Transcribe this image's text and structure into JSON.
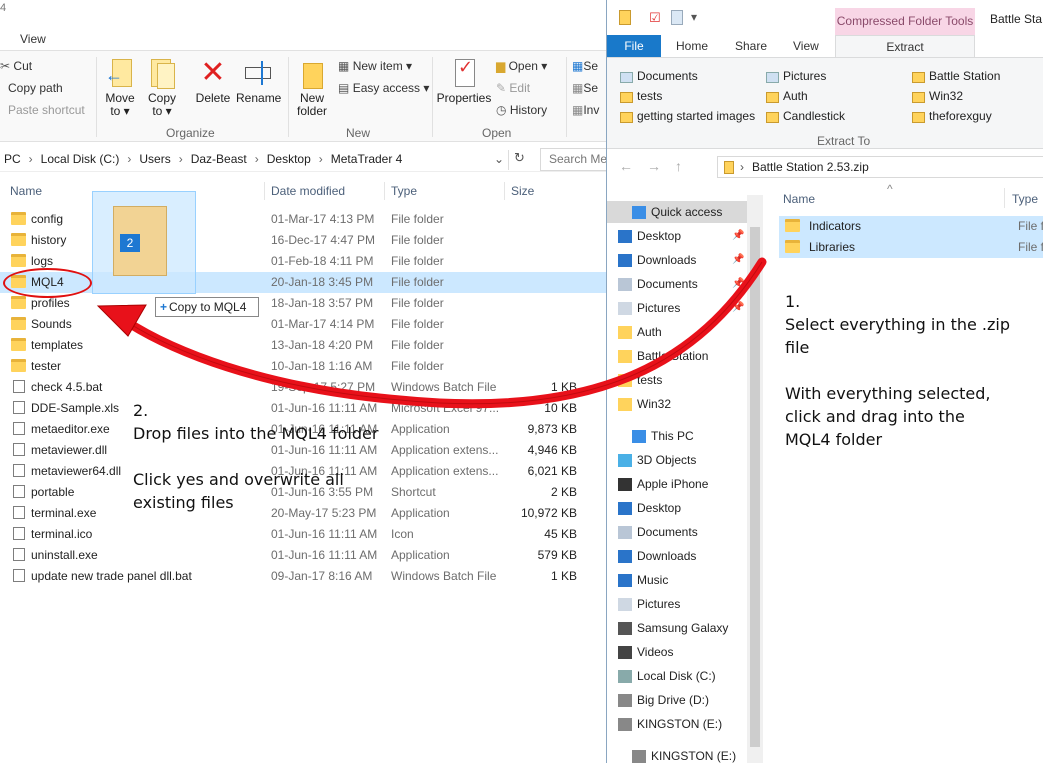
{
  "left_window": {
    "title_fragment": "4",
    "tab_view": "View",
    "ribbon": {
      "cut": "Cut",
      "copy_path": "Copy path",
      "paste_shortcut": "Paste shortcut",
      "move_to": "Move\nto ▾",
      "copy_to": "Copy\nto ▾",
      "delete": "Delete",
      "rename": "Rename",
      "new_folder": "New\nfolder",
      "new_item": "New item ▾",
      "easy_access": "Easy access ▾",
      "properties": "Properties",
      "open": "Open ▾",
      "edit": "Edit",
      "history": "History",
      "select_partial_1": "Se",
      "select_partial_2": "Se",
      "select_partial_3": "Inv",
      "group_organize": "Organize",
      "group_new": "New",
      "group_open": "Open"
    },
    "address": {
      "segments": [
        "PC",
        "Local Disk (C:)",
        "Users",
        "Daz-Beast",
        "Desktop",
        "MetaTrader 4"
      ],
      "search_placeholder": "Search Me"
    },
    "columns": {
      "name": "Name",
      "date": "Date modified",
      "type": "Type",
      "size": "Size"
    },
    "files": [
      {
        "name": "config",
        "date": "01-Mar-17 4:13 PM",
        "type": "File folder",
        "size": "",
        "kind": "folder"
      },
      {
        "name": "history",
        "date": "16-Dec-17 4:47 PM",
        "type": "File folder",
        "size": "",
        "kind": "folder"
      },
      {
        "name": "logs",
        "date": "01-Feb-18 4:11 PM",
        "type": "File folder",
        "size": "",
        "kind": "folder"
      },
      {
        "name": "MQL4",
        "date": "20-Jan-18 3:45 PM",
        "type": "File folder",
        "size": "",
        "kind": "folder"
      },
      {
        "name": "profiles",
        "date": "18-Jan-18 3:57 PM",
        "type": "File folder",
        "size": "",
        "kind": "folder"
      },
      {
        "name": "Sounds",
        "date": "01-Mar-17 4:14 PM",
        "type": "File folder",
        "size": "",
        "kind": "folder"
      },
      {
        "name": "templates",
        "date": "13-Jan-18 4:20 PM",
        "type": "File folder",
        "size": "",
        "kind": "folder"
      },
      {
        "name": "tester",
        "date": "10-Jan-18 1:16 AM",
        "type": "File folder",
        "size": "",
        "kind": "folder"
      },
      {
        "name": "check 4.5.bat",
        "date": "19-Sep-17 5:27 PM",
        "type": "Windows Batch File",
        "size": "1 KB",
        "kind": "file"
      },
      {
        "name": "DDE-Sample.xls",
        "date": "01-Jun-16 11:11 AM",
        "type": "Microsoft Excel 97...",
        "size": "10 KB",
        "kind": "file"
      },
      {
        "name": "metaeditor.exe",
        "date": "01-Jun-16 11:11 AM",
        "type": "Application",
        "size": "9,873 KB",
        "kind": "file"
      },
      {
        "name": "metaviewer.dll",
        "date": "01-Jun-16 11:11 AM",
        "type": "Application extens...",
        "size": "4,946 KB",
        "kind": "file"
      },
      {
        "name": "metaviewer64.dll",
        "date": "01-Jun-16 11:11 AM",
        "type": "Application extens...",
        "size": "6,021 KB",
        "kind": "file"
      },
      {
        "name": "portable",
        "date": "01-Jun-16 3:55 PM",
        "type": "Shortcut",
        "size": "2 KB",
        "kind": "file"
      },
      {
        "name": "terminal.exe",
        "date": "20-May-17 5:23 PM",
        "type": "Application",
        "size": "10,972 KB",
        "kind": "file"
      },
      {
        "name": "terminal.ico",
        "date": "01-Jun-16 11:11 AM",
        "type": "Icon",
        "size": "45 KB",
        "kind": "file"
      },
      {
        "name": "uninstall.exe",
        "date": "01-Jun-16 11:11 AM",
        "type": "Application",
        "size": "579 KB",
        "kind": "file"
      },
      {
        "name": "update new trade panel dll.bat",
        "date": "09-Jan-17 8:16 AM",
        "type": "Windows Batch File",
        "size": "1 KB",
        "kind": "file"
      }
    ],
    "drag_badge": "2",
    "copy_tooltip": "Copy to MQL4"
  },
  "right_window": {
    "context_tab": "Compressed Folder Tools",
    "title": "Battle Sta",
    "tabs": {
      "file": "File",
      "home": "Home",
      "share": "Share",
      "view": "View",
      "extract": "Extract"
    },
    "destinations": [
      [
        "Documents",
        "Pictures",
        "Battle Station"
      ],
      [
        "tests",
        "Auth",
        "Win32"
      ],
      [
        "getting started images",
        "Candlestick",
        "theforexguy"
      ]
    ],
    "extract_to": "Extract To",
    "path": "Battle Station 2.53.zip",
    "columns": {
      "name": "Name",
      "type": "Type"
    },
    "zip_items": [
      {
        "name": "Indicators",
        "type": "File f"
      },
      {
        "name": "Libraries",
        "type": "File f"
      }
    ],
    "nav": {
      "quick_access": "Quick access",
      "quick_items": [
        "Desktop",
        "Downloads",
        "Documents",
        "Pictures",
        "Auth",
        "Battle Station",
        "tests",
        "Win32"
      ],
      "this_pc": "This PC",
      "pc_items": [
        "3D Objects",
        "Apple iPhone",
        "Desktop",
        "Documents",
        "Downloads",
        "Music",
        "Pictures",
        "Samsung Galaxy",
        "Videos",
        "Local Disk (C:)",
        "Big Drive (D:)",
        "KINGSTON (E:)"
      ],
      "bottom_item": "KINGSTON (E:)"
    }
  },
  "annotations": {
    "step1": "1.\nSelect everything in the .zip\nfile\n\nWith everything selected,\nclick and drag into the\nMQL4 folder",
    "step2": "2.\nDrop files into the MQL4 folder\n\nClick yes and overwrite all\nexisting files",
    "arrow_color": "#e8111a"
  }
}
